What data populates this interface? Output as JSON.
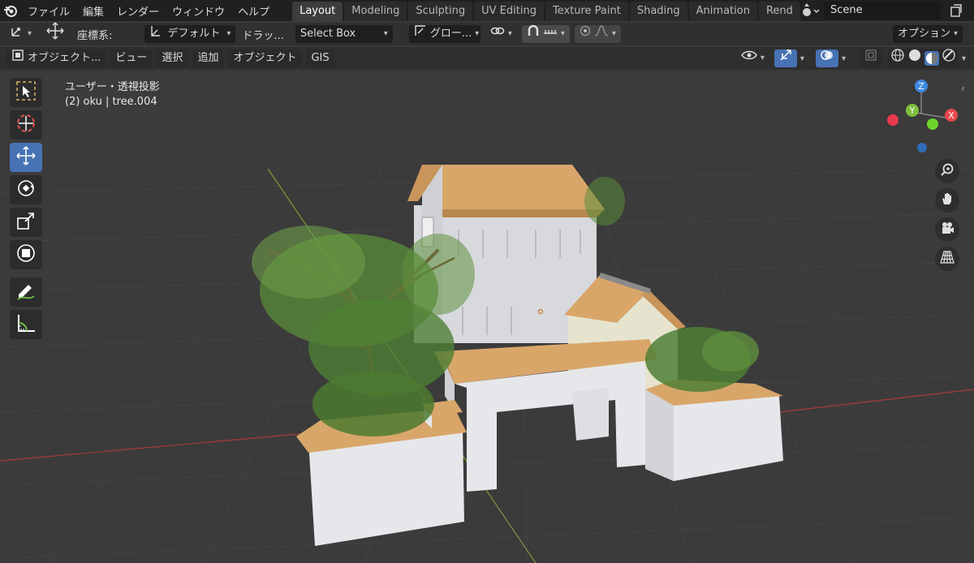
{
  "topbar": {
    "menu": [
      "ファイル",
      "編集",
      "レンダー",
      "ウィンドウ",
      "ヘルプ"
    ],
    "tabs": [
      {
        "label": "Layout",
        "active": true
      },
      {
        "label": "Modeling"
      },
      {
        "label": "Sculpting"
      },
      {
        "label": "UV Editing"
      },
      {
        "label": "Texture Paint"
      },
      {
        "label": "Shading"
      },
      {
        "label": "Animation"
      },
      {
        "label": "Rend"
      }
    ],
    "scene_name": "Scene"
  },
  "header": {
    "coord_system_label": "座標系:",
    "orientation_value": "デフォルト",
    "drag_label": "ドラッ...",
    "select_mode": "Select Box",
    "transform_pivot": "グロー...",
    "options_label": "オプション"
  },
  "view_header": {
    "mode": "オブジェクト...",
    "menus": [
      "ビュー",
      "選択",
      "追加",
      "オブジェクト",
      "GIS"
    ]
  },
  "viewport": {
    "view_name": "ユーザー・透視投影",
    "object_info": "(2) oku | tree.004"
  },
  "gizmo": {
    "z_label": "Z",
    "y_label": "Y",
    "x_label": "X",
    "colors": {
      "x": "#e5484d",
      "y": "#7fbf3f",
      "z": "#3d88e0"
    }
  },
  "toolbar": {
    "tools": [
      "select-box",
      "cursor",
      "move",
      "rotate",
      "scale",
      "transform",
      "annotate",
      "measure"
    ],
    "active": "move"
  },
  "colors": {
    "accent": "#4772b3",
    "roof": "#d9a66a",
    "wall": "#dcdde2",
    "foliage": "#5a8c3a",
    "trunk": "#7a3a2a"
  }
}
